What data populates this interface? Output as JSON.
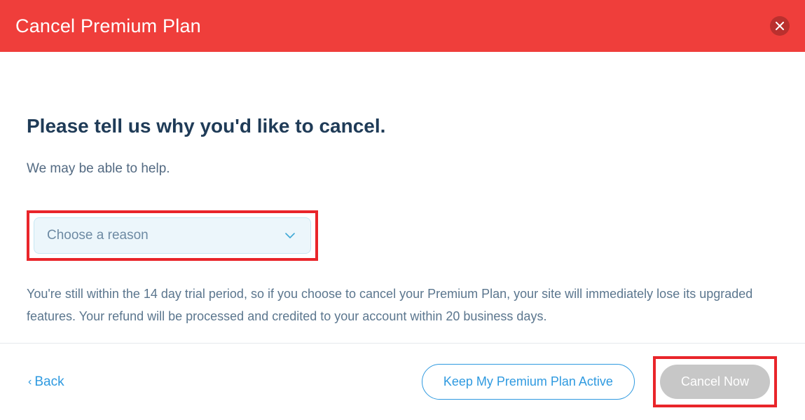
{
  "header": {
    "title": "Cancel Premium Plan"
  },
  "body": {
    "heading": "Please tell us why you'd like to cancel.",
    "subheading": "We may be able to help.",
    "dropdown_placeholder": "Choose a reason",
    "info": "You're still within the 14 day trial period, so if you choose to cancel your Premium Plan, your site will immediately lose its upgraded features. Your refund will be processed and credited to your account within 20 business days."
  },
  "footer": {
    "back_label": "Back",
    "keep_label": "Keep My Premium Plan Active",
    "cancel_label": "Cancel Now"
  },
  "icons": {
    "close": "close-icon",
    "chevron": "chevron-down-icon",
    "back_arrow": "chevron-left-icon"
  }
}
